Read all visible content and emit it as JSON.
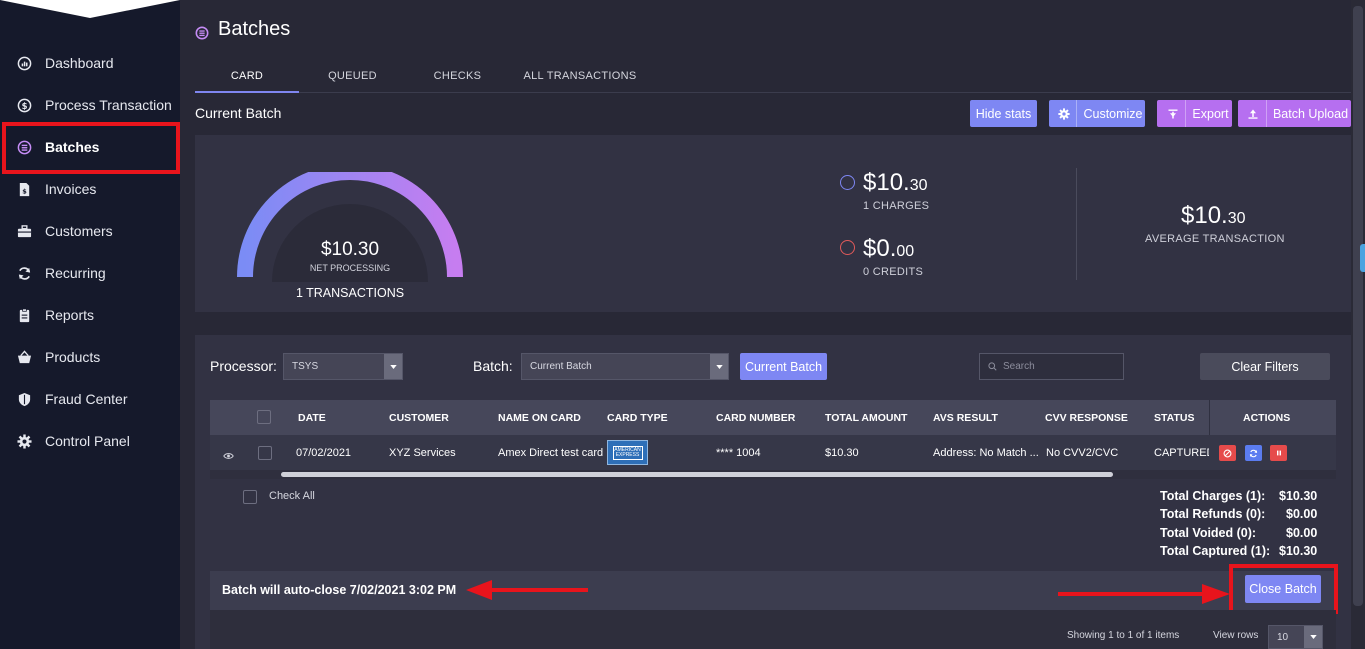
{
  "sidebar": {
    "items": [
      {
        "label": "Dashboard",
        "icon": "dashboard-icon"
      },
      {
        "label": "Process Transaction",
        "icon": "dollar-circle-icon"
      },
      {
        "label": "Batches",
        "icon": "batches-icon"
      },
      {
        "label": "Invoices",
        "icon": "invoice-icon"
      },
      {
        "label": "Customers",
        "icon": "briefcase-icon"
      },
      {
        "label": "Recurring",
        "icon": "refresh-icon"
      },
      {
        "label": "Reports",
        "icon": "clipboard-icon"
      },
      {
        "label": "Products",
        "icon": "basket-icon"
      },
      {
        "label": "Fraud Center",
        "icon": "shield-icon"
      },
      {
        "label": "Control Panel",
        "icon": "gear-icon"
      }
    ],
    "active": "Batches"
  },
  "page": {
    "title": "Batches",
    "tabs": [
      "CARD",
      "QUEUED",
      "CHECKS",
      "ALL TRANSACTIONS"
    ],
    "active_tab": "CARD",
    "section_title": "Current Batch"
  },
  "toolbar": {
    "hide_stats": "Hide stats",
    "customize": "Customize",
    "export": "Export",
    "batch_upload": "Batch Upload"
  },
  "stats": {
    "gauge_value": "$10.30",
    "gauge_label": "NET PROCESSING",
    "gauge_fill": 1.0,
    "transactions": "1 TRANSACTIONS",
    "charges_main": "$10.",
    "charges_cents": "30",
    "charges_label": "1 CHARGES",
    "credits_main": "$0.",
    "credits_cents": "00",
    "credits_label": "0 CREDITS",
    "avg_main": "$10.",
    "avg_cents": "30",
    "avg_label": "AVERAGE TRANSACTION"
  },
  "filters": {
    "processor_label": "Processor:",
    "processor_value": "TSYS",
    "batch_label": "Batch:",
    "batch_value": "Current Batch",
    "current_batch_button": "Current Batch",
    "search_placeholder": "Search",
    "clear_filters": "Clear Filters"
  },
  "table": {
    "columns": [
      "DATE",
      "CUSTOMER",
      "NAME ON CARD",
      "CARD TYPE",
      "CARD NUMBER",
      "TOTAL AMOUNT",
      "AVS RESULT",
      "CVV RESPONSE",
      "STATUS",
      "ACTIONS"
    ],
    "rows": [
      {
        "date": "07/02/2021",
        "customer": "XYZ Services",
        "name_on_card": "Amex Direct test card",
        "card_type": "AMERICAN EXPRESS",
        "card_number": "**** 1004",
        "total_amount": "$10.30",
        "avs_result": "Address: No Match ...",
        "cvv_response": "No CVV2/CVC",
        "status": "CAPTURED"
      }
    ],
    "check_all": "Check All"
  },
  "totals": [
    {
      "label": "Total Charges (1):",
      "value": "$10.30"
    },
    {
      "label": "Total Refunds (0):",
      "value": "$0.00"
    },
    {
      "label": "Total Voided (0):",
      "value": "$0.00"
    },
    {
      "label": "Total Captured (1):",
      "value": "$10.30"
    }
  ],
  "footer": {
    "auto_close": "Batch will auto-close 7/02/2021 3:02 PM",
    "close_batch": "Close Batch",
    "showing": "Showing 1 to 1 of 1 items",
    "view_rows_label": "View rows",
    "view_rows_value": "10"
  },
  "colors": {
    "accent_blue": "#7e87f3",
    "accent_purple": "#b66ff0",
    "annotation_red": "#e8141c",
    "sidebar_bg": "#15192b"
  }
}
